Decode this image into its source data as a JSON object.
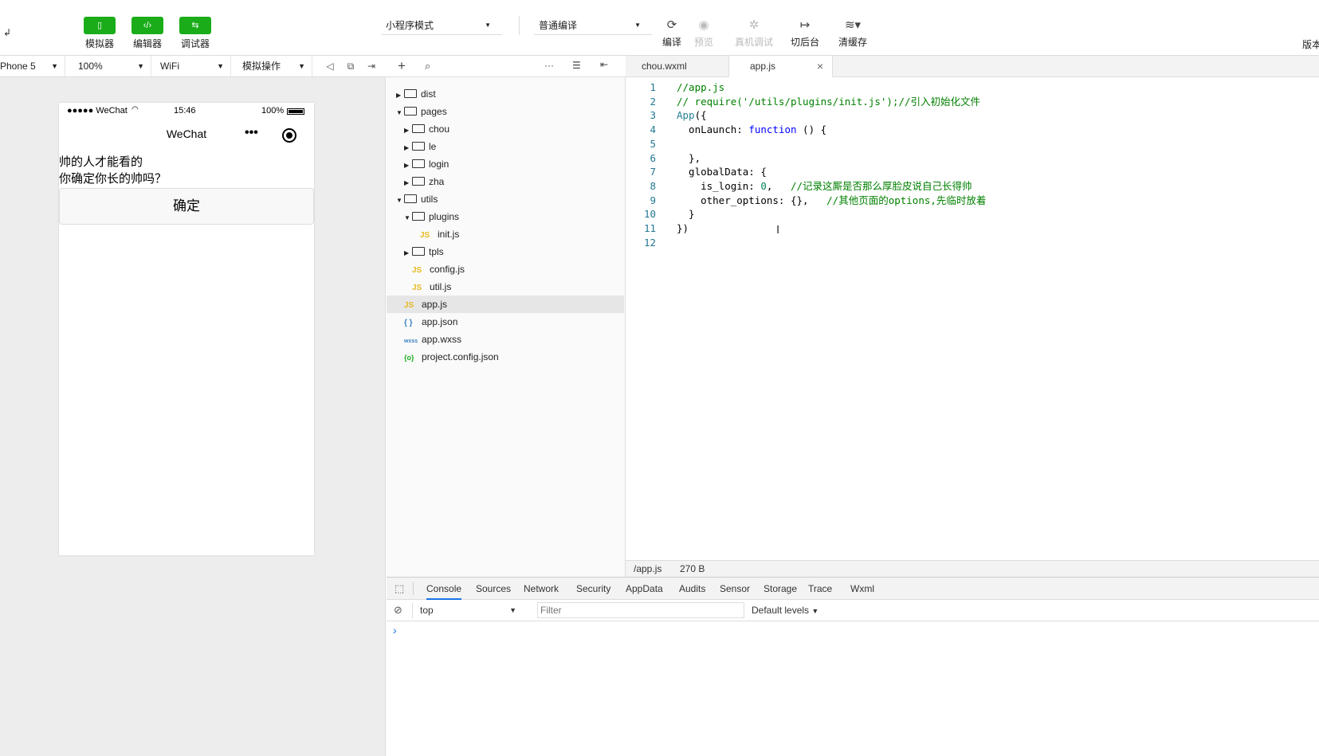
{
  "toolbar": {
    "buttons": [
      {
        "label": "模拟器",
        "icon": "phone-icon"
      },
      {
        "label": "编辑器",
        "icon": "code-icon"
      },
      {
        "label": "调试器",
        "icon": "debug-icon"
      }
    ],
    "mode_select": "小程序模式",
    "compile_select": "普通编译",
    "actions": {
      "compile": "编译",
      "preview": "预览",
      "real_debug": "真机调试",
      "background": "切后台",
      "clear_cache": "清缓存",
      "version": "版本"
    }
  },
  "simulator_bar": {
    "device": "Phone 5",
    "zoom": "100%",
    "network": "WiFi",
    "operation": "模拟操作"
  },
  "phone": {
    "status": {
      "carrier": "●●●●● WeChat",
      "time": "15:46",
      "battery": "100%"
    },
    "nav_title": "WeChat",
    "line1": "帅的人才能看的",
    "line2": "你确定你长的帅吗？",
    "confirm_label": "确定"
  },
  "explorer": {
    "items": [
      {
        "label": "dist",
        "type": "folder",
        "depth": 0,
        "expanded": false
      },
      {
        "label": "pages",
        "type": "folder",
        "depth": 0,
        "expanded": true
      },
      {
        "label": "chou",
        "type": "folder",
        "depth": 1,
        "expanded": false
      },
      {
        "label": "le",
        "type": "folder",
        "depth": 1,
        "expanded": false
      },
      {
        "label": "login",
        "type": "folder",
        "depth": 1,
        "expanded": false
      },
      {
        "label": "zha",
        "type": "folder",
        "depth": 1,
        "expanded": false
      },
      {
        "label": "utils",
        "type": "folder",
        "depth": 0,
        "expanded": true
      },
      {
        "label": "plugins",
        "type": "folder",
        "depth": 1,
        "expanded": true
      },
      {
        "label": "init.js",
        "type": "js",
        "depth": 2
      },
      {
        "label": "tpls",
        "type": "folder",
        "depth": 1,
        "expanded": false
      },
      {
        "label": "config.js",
        "type": "js",
        "depth": 1
      },
      {
        "label": "util.js",
        "type": "js",
        "depth": 1
      },
      {
        "label": "app.js",
        "type": "js",
        "depth": 0,
        "selected": true
      },
      {
        "label": "app.json",
        "type": "json",
        "depth": 0
      },
      {
        "label": "app.wxss",
        "type": "wxss",
        "depth": 0
      },
      {
        "label": "project.config.json",
        "type": "config",
        "depth": 0
      }
    ]
  },
  "editor": {
    "tabs": [
      {
        "label": "chou.wxml",
        "active": false
      },
      {
        "label": "app.js",
        "active": true,
        "close": "×"
      }
    ],
    "lines": [
      {
        "n": "1",
        "parts": [
          {
            "t": "//app.js",
            "c": "com"
          }
        ]
      },
      {
        "n": "2",
        "parts": [
          {
            "t": "// require('/utils/plugins/init.js');//引入初始化文件",
            "c": "com"
          }
        ]
      },
      {
        "n": "3",
        "parts": [
          {
            "t": "App",
            "c": "fn"
          },
          {
            "t": "({",
            "c": ""
          }
        ]
      },
      {
        "n": "4",
        "parts": [
          {
            "t": "  onLaunch: ",
            "c": ""
          },
          {
            "t": "function",
            "c": "kw"
          },
          {
            "t": " () {",
            "c": ""
          }
        ]
      },
      {
        "n": "5",
        "parts": []
      },
      {
        "n": "6",
        "parts": [
          {
            "t": "  },",
            "c": ""
          }
        ]
      },
      {
        "n": "7",
        "parts": [
          {
            "t": "  globalData: {",
            "c": ""
          }
        ]
      },
      {
        "n": "8",
        "parts": [
          {
            "t": "    is_login: ",
            "c": ""
          },
          {
            "t": "0",
            "c": "num"
          },
          {
            "t": ",   ",
            "c": ""
          },
          {
            "t": "//记录这厮是否那么厚脸皮说自己长得帅",
            "c": "com"
          }
        ]
      },
      {
        "n": "9",
        "parts": [
          {
            "t": "    other_options: {},   ",
            "c": ""
          },
          {
            "t": "//其他页面的options,先临时放着",
            "c": "com"
          }
        ]
      },
      {
        "n": "10",
        "parts": [
          {
            "t": "  }",
            "c": ""
          }
        ]
      },
      {
        "n": "11",
        "parts": [
          {
            "t": "})",
            "c": ""
          }
        ]
      },
      {
        "n": "12",
        "parts": []
      }
    ],
    "status_path": "/app.js",
    "status_size": "270 B"
  },
  "devtools": {
    "tabs": [
      "Console",
      "Sources",
      "Network",
      "Security",
      "AppData",
      "Audits",
      "Sensor",
      "Storage",
      "Trace",
      "Wxml"
    ],
    "active_tab": "Console",
    "context": "top",
    "filter_placeholder": "Filter",
    "levels": "Default levels",
    "prompt": "›"
  }
}
